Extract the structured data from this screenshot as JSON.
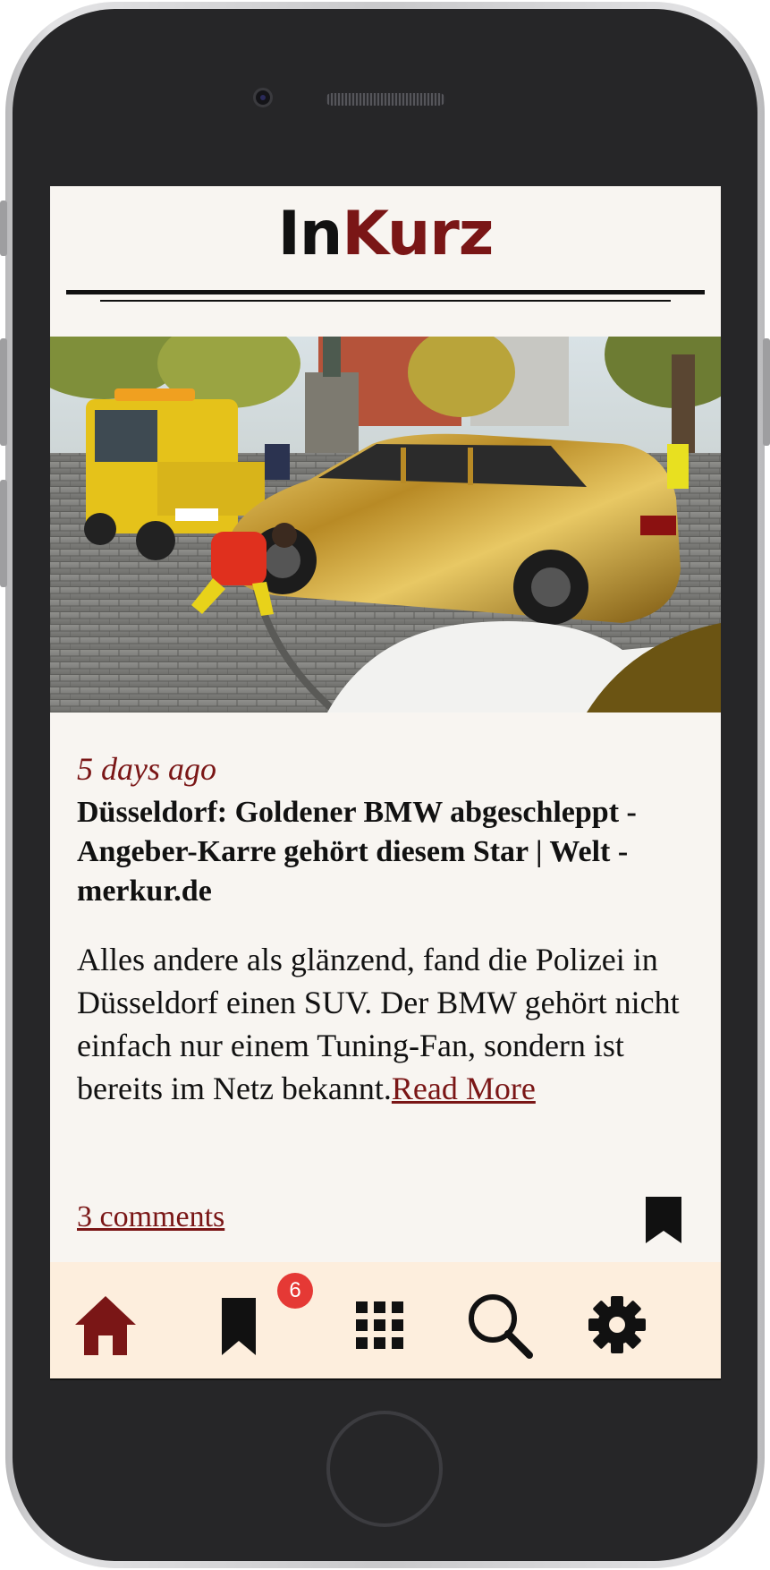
{
  "app": {
    "logo_part1": "In",
    "logo_part2": "Kurz",
    "brand_color": "#7a1616",
    "background_color": "#f8f5f1",
    "nav_background": "#fdeedd"
  },
  "article": {
    "image_alt": "Gold-wrapped BMW SUV being towed by a yellow tow truck in a square",
    "timestamp": "5 days ago",
    "headline": "Düsseldorf: Goldener BMW abgeschleppt - Angeber-Karre gehört diesem Star | Welt - merkur.de",
    "summary": "Alles andere als glänzend, fand die Polizei in Düsseldorf einen SUV. Der BMW gehört nicht einfach nur einem Tuning-Fan, sondern ist bereits im Netz bekannt.",
    "read_more_label": "Read More",
    "comments_label": "3 comments",
    "bookmark_icon": "bookmark-icon"
  },
  "bottom_nav": {
    "items": [
      {
        "name": "home",
        "icon": "home-icon",
        "active": true
      },
      {
        "name": "bookmarks",
        "icon": "bookmark-icon",
        "badge": "6"
      },
      {
        "name": "categories",
        "icon": "grid-icon"
      },
      {
        "name": "search",
        "icon": "search-icon"
      },
      {
        "name": "settings",
        "icon": "gear-icon"
      }
    ]
  }
}
